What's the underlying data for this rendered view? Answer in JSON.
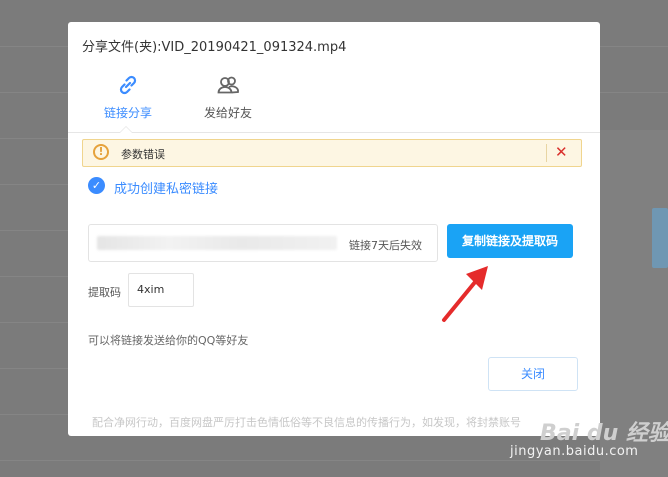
{
  "dialog": {
    "title": "分享文件(夹):VID_20190421_091324.mp4",
    "tabs": [
      {
        "label": "链接分享",
        "icon": "link-icon",
        "active": true
      },
      {
        "label": "发给好友",
        "icon": "friends-icon",
        "active": false
      }
    ],
    "alert": {
      "icon": "warning-icon",
      "message": "参数错误",
      "close_icon": "close-icon"
    },
    "success": {
      "icon": "check-circle-icon",
      "message": "成功创建私密链接"
    },
    "link": {
      "url_hint": "h",
      "url_blur_end": "?",
      "expire_text": "链接7天后失效"
    },
    "copy_button_label": "复制链接及提取码",
    "code": {
      "label": "提取码",
      "value": "4xim"
    },
    "hint": "可以将链接发送给你的QQ等好友",
    "close_button_label": "关闭",
    "footer": "配合净网行动，百度网盘严厉打击色情低俗等不良信息的传播行为，如发现，将封禁账号"
  },
  "watermark": {
    "brand": "Bai du 经验",
    "url": "jingyan.baidu.com"
  },
  "colors": {
    "accent": "#3b8cff",
    "copy_button": "#1aa3f5",
    "alert_bg": "#fdf6e3",
    "alert_close": "#d9302c",
    "arrow": "#e52b2b"
  }
}
